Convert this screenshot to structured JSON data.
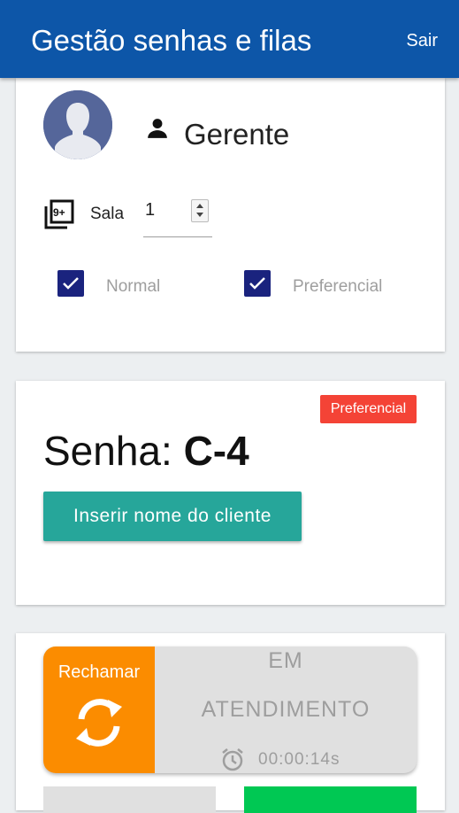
{
  "appbar": {
    "title": "Gestão senhas e filas",
    "logout_label": "Sair"
  },
  "user": {
    "role": "Gerente",
    "room_label": "Sala",
    "room_value": "1",
    "queues": [
      {
        "label": "Normal",
        "checked": true
      },
      {
        "label": "Preferencial",
        "checked": true
      }
    ]
  },
  "ticket": {
    "badge": "Preferencial",
    "prefix": "Senha: ",
    "code": "C-4",
    "client_button": "Inserir nome do cliente"
  },
  "actions": {
    "recall_label": "Rechamar",
    "status_line1": "EM",
    "status_line2": "ATENDIMENTO",
    "timer": "00:00:14s"
  },
  "colors": {
    "appbar": "#0d56a8",
    "checkbox": "#1a237e",
    "badge": "#f44336",
    "client_button": "#26a69a",
    "recall": "#fb8c00",
    "green_button": "#00c853"
  }
}
